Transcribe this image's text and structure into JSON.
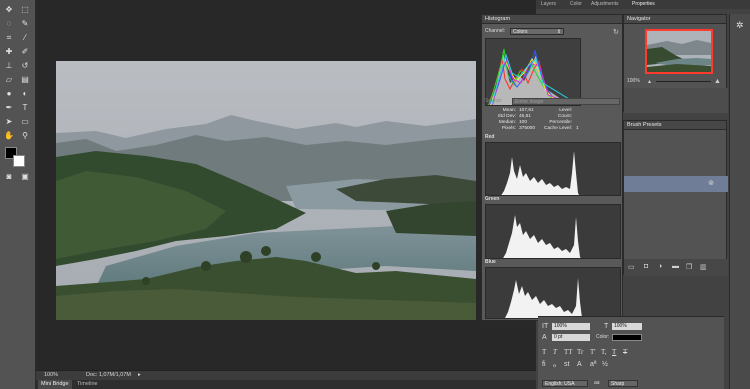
{
  "top_bar": {
    "tabs": [
      "Layers",
      "Color",
      "Adjustments",
      "Properties"
    ]
  },
  "tools": {
    "items": [
      "move-tool",
      "marquee-tool",
      "lasso-tool",
      "quick-select-tool",
      "crop-tool",
      "eyedropper-tool",
      "healing-tool",
      "brush-tool",
      "clone-stamp-tool",
      "history-brush-tool",
      "eraser-tool",
      "gradient-tool",
      "blur-tool",
      "dodge-tool",
      "pen-tool",
      "type-tool",
      "path-select-tool",
      "shape-tool",
      "hand-tool",
      "zoom-tool"
    ],
    "foreground_color": "#000000",
    "background_color": "#ffffff"
  },
  "status": {
    "zoom": "100%",
    "doc": "Doc: 1,07M/1,07M"
  },
  "bottom_tabs": [
    "Mini Bridge",
    "Timeline"
  ],
  "histogram": {
    "title": "Histogram",
    "channel_label": "Channel:",
    "channel_value": "Colors",
    "source_label": "Source:",
    "source_value": "Entire Image",
    "stats": {
      "mean_label": "Mean:",
      "mean": "107,61",
      "stddev_label": "Std Dev:",
      "stddev": "45,61",
      "median_label": "Median:",
      "median": "100",
      "pixels_label": "Pixels:",
      "pixels": "375000",
      "level_label": "Level:",
      "level": "",
      "count_label": "Count:",
      "count": "",
      "percentile_label": "Percentile:",
      "percentile": "",
      "cache_label": "Cache Level:",
      "cache": "1"
    },
    "channels": [
      "Red",
      "Green",
      "Blue"
    ]
  },
  "navigator": {
    "title": "Navigator",
    "zoom": "100%"
  },
  "brush_presets": {
    "title": "Brush Presets"
  },
  "character": {
    "tracking": "100%",
    "scale": "100%",
    "baseline": "0 pt",
    "color_label": "Color:",
    "style_buttons": [
      "T",
      "T",
      "TT",
      "Tr",
      "T'",
      "T,",
      "T",
      "T"
    ],
    "language": "English: USA",
    "aa_label": "aa",
    "anti_alias": "Sharp"
  },
  "colors": {
    "panel": "#535353",
    "canvas_bg": "#282828",
    "selection_blue": "#6f7d96",
    "navigator_red": "#ff3b30"
  }
}
